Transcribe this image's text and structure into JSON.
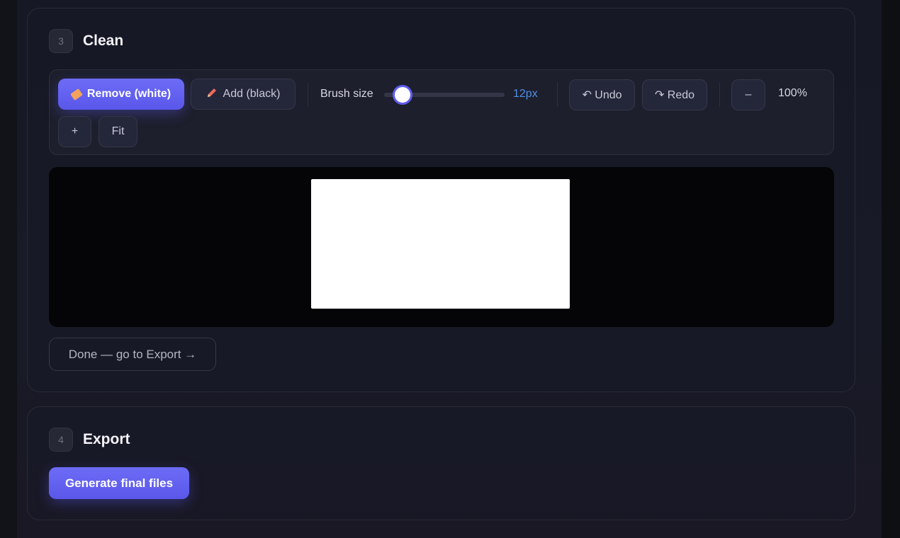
{
  "clean": {
    "step_number": "3",
    "title": "Clean",
    "toolbar": {
      "remove_label": "Remove (white)",
      "add_label": "Add (black)",
      "brush_size_label": "Brush size",
      "brush_size_value": "12px",
      "brush_size_level": 0.15,
      "undo_label": "↶ Undo",
      "redo_label": "↷ Redo",
      "zoom_out_label": "–",
      "zoom_level": "100%",
      "zoom_in_label": "+",
      "fit_label": "Fit"
    },
    "done_label": "Done — go to Export →"
  },
  "export": {
    "step_number": "4",
    "title": "Export",
    "generate_label": "Generate final files"
  },
  "colors": {
    "accent": "#5f5cf0",
    "brush_value": "#4f8fe8",
    "canvas_bg": "#050507"
  }
}
